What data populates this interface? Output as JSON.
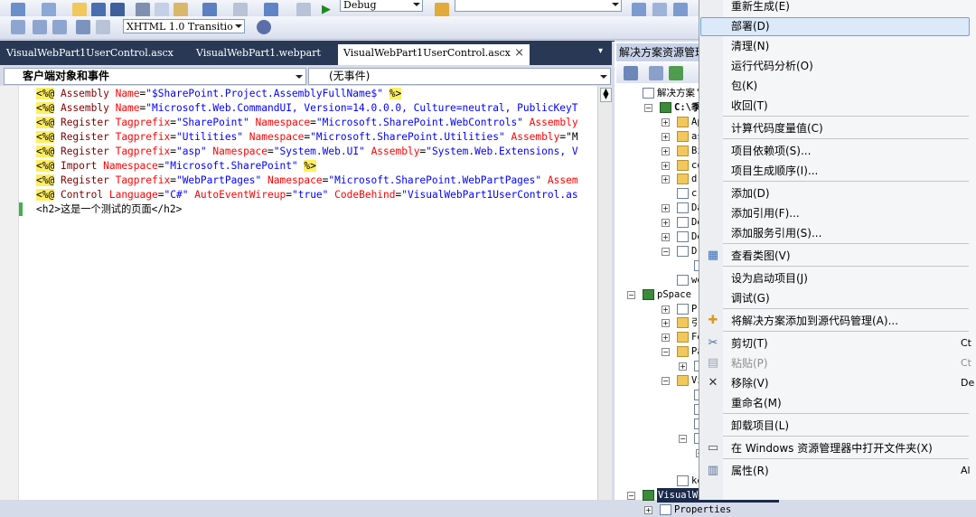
{
  "toolbar": {
    "config": "Debug",
    "doctype": "XHTML 1.0 Transitio"
  },
  "tabs": [
    {
      "label": "VisualWebPart1UserControl.ascx"
    },
    {
      "label": "VisualWebPart1.webpart"
    },
    {
      "label": "VisualWebPart1UserControl.ascx",
      "close": "×"
    }
  ],
  "editor": {
    "object_combo": "客户端对象和事件",
    "event_combo": "(无事件)",
    "lines": [
      [
        [
          "d",
          "<%@"
        ],
        [
          "t",
          " Assembly "
        ],
        [
          "a",
          "Name"
        ],
        [
          "p",
          "="
        ],
        [
          "v",
          "\"$SharePoint.Project.AssemblyFullName$\""
        ],
        [
          "p",
          " "
        ],
        [
          "d",
          "%>"
        ]
      ],
      [
        [
          "d",
          "<%@"
        ],
        [
          "t",
          " Assembly "
        ],
        [
          "a",
          "Name"
        ],
        [
          "p",
          "="
        ],
        [
          "v",
          "\"Microsoft.Web.CommandUI, Version=14.0.0.0, Culture=neutral, PublicKeyT"
        ]
      ],
      [
        [
          "d",
          "<%@"
        ],
        [
          "t",
          " Register "
        ],
        [
          "a",
          "Tagprefix"
        ],
        [
          "p",
          "="
        ],
        [
          "v",
          "\"SharePoint\""
        ],
        [
          "p",
          " "
        ],
        [
          "a",
          "Namespace"
        ],
        [
          "p",
          "="
        ],
        [
          "v",
          "\"Microsoft.SharePoint.WebControls\""
        ],
        [
          "p",
          " "
        ],
        [
          "a",
          "Assembly"
        ]
      ],
      [
        [
          "d",
          "<%@"
        ],
        [
          "t",
          " Register "
        ],
        [
          "a",
          "Tagprefix"
        ],
        [
          "p",
          "="
        ],
        [
          "v",
          "\"Utilities\""
        ],
        [
          "p",
          " "
        ],
        [
          "a",
          "Namespace"
        ],
        [
          "p",
          "="
        ],
        [
          "v",
          "\"Microsoft.SharePoint.Utilities\""
        ],
        [
          "p",
          " "
        ],
        [
          "a",
          "Assembly"
        ],
        [
          "p",
          "=\"M"
        ]
      ],
      [
        [
          "d",
          "<%@"
        ],
        [
          "t",
          " Register "
        ],
        [
          "a",
          "Tagprefix"
        ],
        [
          "p",
          "="
        ],
        [
          "v",
          "\"asp\""
        ],
        [
          "p",
          " "
        ],
        [
          "a",
          "Namespace"
        ],
        [
          "p",
          "="
        ],
        [
          "v",
          "\"System.Web.UI\""
        ],
        [
          "p",
          " "
        ],
        [
          "a",
          "Assembly"
        ],
        [
          "p",
          "="
        ],
        [
          "v",
          "\"System.Web.Extensions, V"
        ]
      ],
      [
        [
          "d",
          "<%@"
        ],
        [
          "t",
          " Import "
        ],
        [
          "a",
          "Namespace"
        ],
        [
          "p",
          "="
        ],
        [
          "v",
          "\"Microsoft.SharePoint\""
        ],
        [
          "p",
          " "
        ],
        [
          "d",
          "%>"
        ]
      ],
      [
        [
          "d",
          "<%@"
        ],
        [
          "t",
          " Register "
        ],
        [
          "a",
          "Tagprefix"
        ],
        [
          "p",
          "="
        ],
        [
          "v",
          "\"WebPartPages\""
        ],
        [
          "p",
          " "
        ],
        [
          "a",
          "Namespace"
        ],
        [
          "p",
          "="
        ],
        [
          "v",
          "\"Microsoft.SharePoint.WebPartPages\""
        ],
        [
          "p",
          " "
        ],
        [
          "a",
          "Assem"
        ]
      ],
      [
        [
          "d",
          "<%@"
        ],
        [
          "t",
          " Control "
        ],
        [
          "a",
          "Language"
        ],
        [
          "p",
          "="
        ],
        [
          "v",
          "\"C#\""
        ],
        [
          "p",
          " "
        ],
        [
          "a",
          "AutoEventWireup"
        ],
        [
          "p",
          "="
        ],
        [
          "v",
          "\"true\""
        ],
        [
          "p",
          " "
        ],
        [
          "a",
          "CodeBehind"
        ],
        [
          "p",
          "="
        ],
        [
          "v",
          "\"VisualWebPart1UserControl.as"
        ]
      ],
      [
        [
          "p",
          "<h2>这是一个测试的页面</h2>"
        ]
      ]
    ]
  },
  "solution_explorer": {
    "title": "解决方案资源管理器",
    "rows": [
      {
        "text": "解决方案'V",
        "indent": 0,
        "icon": "file",
        "exp": ""
      },
      {
        "text": "C:\\季贸",
        "indent": 1,
        "icon": "proj",
        "exp": "−",
        "bold": true
      },
      {
        "text": "App_",
        "indent": 2,
        "icon": "folder",
        "exp": "+"
      },
      {
        "text": "aspn",
        "indent": 2,
        "icon": "folder",
        "exp": "+"
      },
      {
        "text": "Bin",
        "indent": 2,
        "icon": "folder",
        "exp": "+"
      },
      {
        "text": "col",
        "indent": 2,
        "icon": "folder",
        "exp": "+"
      },
      {
        "text": "dra",
        "indent": 2,
        "icon": "folder",
        "exp": "+"
      },
      {
        "text": "cro",
        "indent": 2,
        "icon": "file",
        "exp": ""
      },
      {
        "text": "Dat",
        "indent": 2,
        "icon": "file",
        "exp": "+"
      },
      {
        "text": "Def",
        "indent": 2,
        "icon": "file",
        "exp": "+"
      },
      {
        "text": "Def",
        "indent": 2,
        "icon": "file",
        "exp": "+"
      },
      {
        "text": "Dra",
        "indent": 2,
        "icon": "file",
        "exp": "−"
      },
      {
        "text": "",
        "indent": 3,
        "icon": "file",
        "exp": ""
      },
      {
        "text": "web",
        "indent": 2,
        "icon": "file",
        "exp": ""
      },
      {
        "text": "pSpace",
        "indent": 0,
        "icon": "proj",
        "exp": "−"
      },
      {
        "text": "Proj",
        "indent": 2,
        "icon": "file",
        "exp": "+"
      },
      {
        "text": "引用",
        "indent": 2,
        "icon": "folder",
        "exp": "+"
      },
      {
        "text": "Fea",
        "indent": 2,
        "icon": "folder",
        "exp": "+"
      },
      {
        "text": "Pac",
        "indent": 2,
        "icon": "folder",
        "exp": "−"
      },
      {
        "text": "",
        "indent": 3,
        "icon": "file",
        "exp": "+"
      },
      {
        "text": "Vis",
        "indent": 2,
        "icon": "folder",
        "exp": "−"
      },
      {
        "text": "",
        "indent": 3,
        "icon": "file",
        "exp": ""
      },
      {
        "text": "",
        "indent": 3,
        "icon": "file",
        "exp": ""
      },
      {
        "text": "",
        "indent": 3,
        "icon": "file",
        "exp": ""
      },
      {
        "text": "",
        "indent": 3,
        "icon": "file",
        "exp": "−"
      },
      {
        "text": "",
        "indent": 4,
        "icon": "file",
        "exp": "+"
      },
      {
        "text": "",
        "indent": 4,
        "icon": "file",
        "exp": ""
      },
      {
        "text": "key",
        "indent": 2,
        "icon": "file",
        "exp": ""
      },
      {
        "text": "VisualWebPartProject2",
        "indent": 0,
        "icon": "proj",
        "exp": "−",
        "selected": true
      },
      {
        "text": "Properties",
        "indent": 1,
        "icon": "file",
        "exp": "+"
      }
    ]
  },
  "context_menu": {
    "items": [
      {
        "label": "重新生成(E)",
        "icon": ""
      },
      {
        "label": "部署(D)",
        "icon": "",
        "highlight": true
      },
      {
        "label": "清理(N)",
        "icon": ""
      },
      {
        "label": "运行代码分析(O)",
        "icon": ""
      },
      {
        "label": "包(K)",
        "icon": ""
      },
      {
        "label": "收回(T)",
        "icon": "",
        "sep_after": true
      },
      {
        "label": "计算代码度量值(C)",
        "icon": "",
        "sep_after": true
      },
      {
        "label": "项目依赖项(S)...",
        "icon": ""
      },
      {
        "label": "项目生成顺序(I)...",
        "icon": "",
        "sep_after": true
      },
      {
        "label": "添加(D)",
        "icon": ""
      },
      {
        "label": "添加引用(F)...",
        "icon": ""
      },
      {
        "label": "添加服务引用(S)...",
        "icon": "",
        "sep_after": true
      },
      {
        "label": "查看类图(V)",
        "icon": "class-diagram",
        "sep_after": true
      },
      {
        "label": "设为启动项目(J)",
        "icon": ""
      },
      {
        "label": "调试(G)",
        "icon": "",
        "sep_after": true
      },
      {
        "label": "将解决方案添加到源代码管理(A)...",
        "icon": "add-source-control",
        "sep_after": true
      },
      {
        "label": "剪切(T)",
        "icon": "cut",
        "shortcut": "Ct"
      },
      {
        "label": "粘贴(P)",
        "icon": "paste",
        "shortcut": "Ct",
        "disabled": true
      },
      {
        "label": "移除(V)",
        "icon": "remove",
        "shortcut": "De"
      },
      {
        "label": "重命名(M)",
        "icon": "",
        "sep_after": true
      },
      {
        "label": "卸载项目(L)",
        "icon": "",
        "sep_after": true
      },
      {
        "label": "在 Windows 资源管理器中打开文件夹(X)",
        "icon": "open-folder",
        "sep_after": true
      },
      {
        "label": "属性(R)",
        "icon": "properties",
        "shortcut": "Al"
      }
    ]
  },
  "colors": {
    "tab_bar": "#293955",
    "highlight": "#dbe9f9",
    "delimiter": "#ffee62"
  }
}
